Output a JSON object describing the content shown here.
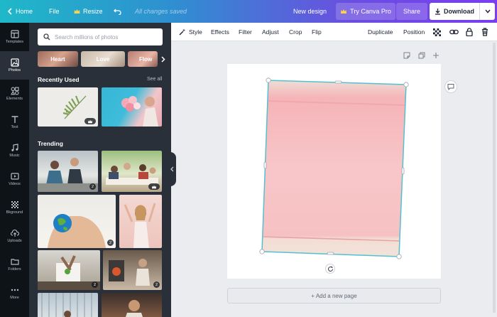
{
  "topbar": {
    "home": "Home",
    "file": "File",
    "resize": "Resize",
    "saved_status": "All changes saved",
    "design_name": "New design",
    "try_pro": "Try Canva Pro",
    "share": "Share",
    "download": "Download"
  },
  "rail": [
    {
      "label": "Templates",
      "icon": "templates-icon"
    },
    {
      "label": "Photos",
      "icon": "photos-icon"
    },
    {
      "label": "Elements",
      "icon": "elements-icon"
    },
    {
      "label": "Text",
      "icon": "text-icon"
    },
    {
      "label": "Music",
      "icon": "music-icon"
    },
    {
      "label": "Videos",
      "icon": "videos-icon"
    },
    {
      "label": "Bkground",
      "icon": "background-icon"
    },
    {
      "label": "Uploads",
      "icon": "uploads-icon"
    },
    {
      "label": "Folders",
      "icon": "folders-icon"
    },
    {
      "label": "More",
      "icon": "more-icon"
    }
  ],
  "panel": {
    "search_placeholder": "Search millions of photos",
    "chips": [
      "Heart",
      "Love",
      "Flow"
    ],
    "recently_used": "Recently Used",
    "see_all": "See all",
    "trending": "Trending",
    "badges": [
      "2",
      "2",
      "2",
      "2"
    ]
  },
  "edit_toolbar": {
    "style": "Style",
    "effects": "Effects",
    "filter": "Filter",
    "adjust": "Adjust",
    "crop": "Crop",
    "flip": "Flip",
    "duplicate": "Duplicate",
    "position": "Position"
  },
  "canvas": {
    "add_page": "+ Add a new page"
  },
  "colors": {
    "rail_bg": "#0e1318",
    "panel_bg": "#293039",
    "selection": "#54c0cf",
    "photo_pink": "#f6c4c6"
  }
}
